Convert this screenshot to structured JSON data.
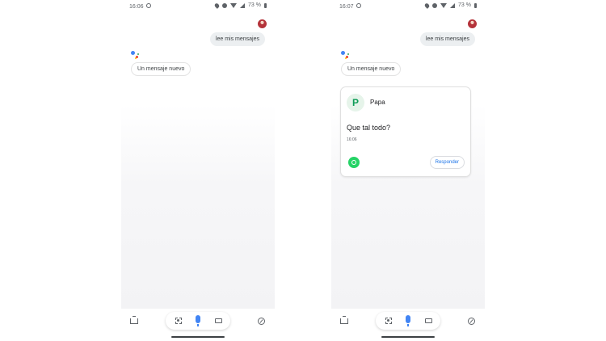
{
  "screens": [
    {
      "status": {
        "time": "16:06",
        "battery": "73 %"
      },
      "user_query": "lee mis mensajes",
      "assistant_reply": "Un mensaje nuevo"
    },
    {
      "status": {
        "time": "16:07",
        "battery": "73 %"
      },
      "user_query": "lee mis mensajes",
      "assistant_reply": "Un mensaje nuevo",
      "message_card": {
        "avatar_letter": "P",
        "contact": "Papa",
        "text": "Que tal todo?",
        "time": "16:06",
        "reply_button": "Responder"
      }
    }
  ],
  "icons": [
    "whatsapp-icon",
    "location-icon",
    "dnd-icon",
    "wifi-icon",
    "signal-icon",
    "battery-icon",
    "snapshot-icon",
    "lens-icon",
    "mic-icon",
    "keyboard-icon",
    "compass-icon"
  ],
  "colors": {
    "assistant_blue": "#4285f4",
    "whatsapp_green": "#25d366",
    "contact_green": "#0f9d58",
    "link_blue": "#1a73e8"
  }
}
